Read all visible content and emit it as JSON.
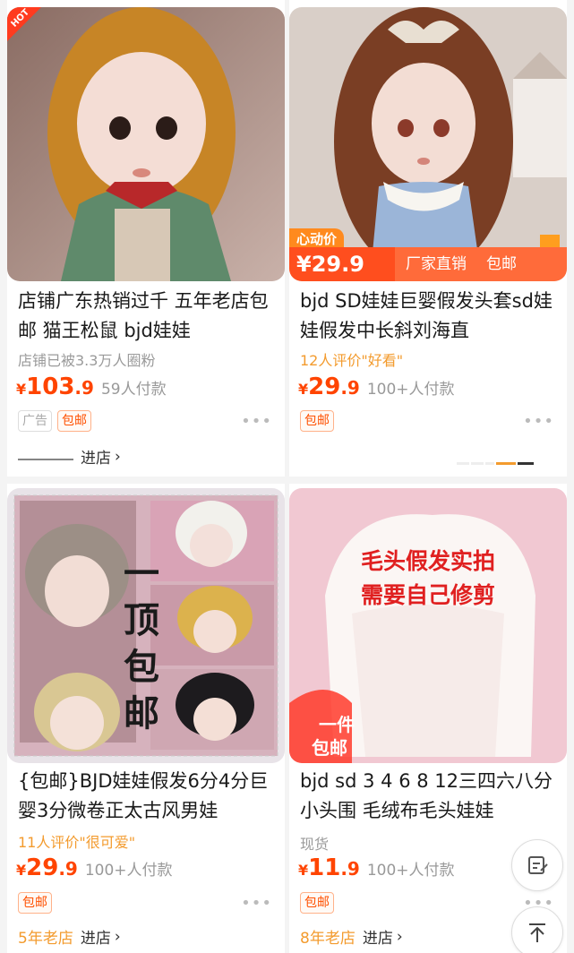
{
  "products": [
    {
      "title": "店铺广东热销过千 五年老店包邮 猫王松鼠 bjd娃娃",
      "subtitle": "店铺已被3.3万人圈粉",
      "price_yen": "¥",
      "price_int": "103",
      "price_dec": ".9",
      "paid": "59人付款",
      "tags": [
        "广告",
        "包邮"
      ],
      "shop_age": "",
      "enter_label": "进店",
      "hot_label": "HOT"
    },
    {
      "title": "bjd SD娃娃巨婴假发头套sd娃娃假发中长斜刘海直",
      "subtitle": "12人评价\"好看\"",
      "price_yen": "¥",
      "price_int": "29",
      "price_dec": ".9",
      "paid": "100+人付款",
      "tags": [
        "包邮"
      ],
      "promo_flag": "心动价",
      "promo_price": "¥29.9",
      "promo_label1": "厂家直销",
      "promo_label2": "包邮"
    },
    {
      "title": "{包邮}BJD娃娃假发6分4分巨婴3分微卷正太古风男娃",
      "subtitle": "11人评价\"很可爱\"",
      "price_yen": "¥",
      "price_int": "29",
      "price_dec": ".9",
      "paid": "100+人付款",
      "tags": [
        "包邮"
      ],
      "shop_age": "5年老店",
      "enter_label": "进店",
      "img_text": "一顶包邮"
    },
    {
      "title": "bjd sd 3 4 6 8 12三四六八分小头围 毛绒布毛头娃娃",
      "subtitle": "现货",
      "price_yen": "¥",
      "price_int": "11",
      "price_dec": ".9",
      "paid": "100+人付款",
      "tags": [
        "包邮"
      ],
      "shop_age": "8年老店",
      "enter_label": "进店",
      "img_text1": "毛头假发实拍",
      "img_text2": "需要自己修剪",
      "img_badge1": "一件",
      "img_badge2": "包邮"
    }
  ],
  "fab": {
    "edit_icon": "edit-note-icon",
    "top_icon": "back-to-top-icon"
  },
  "colors": {
    "price": "#ff4400",
    "accent_orange": "#f39b2e",
    "tag_border": "#ffb28a"
  }
}
